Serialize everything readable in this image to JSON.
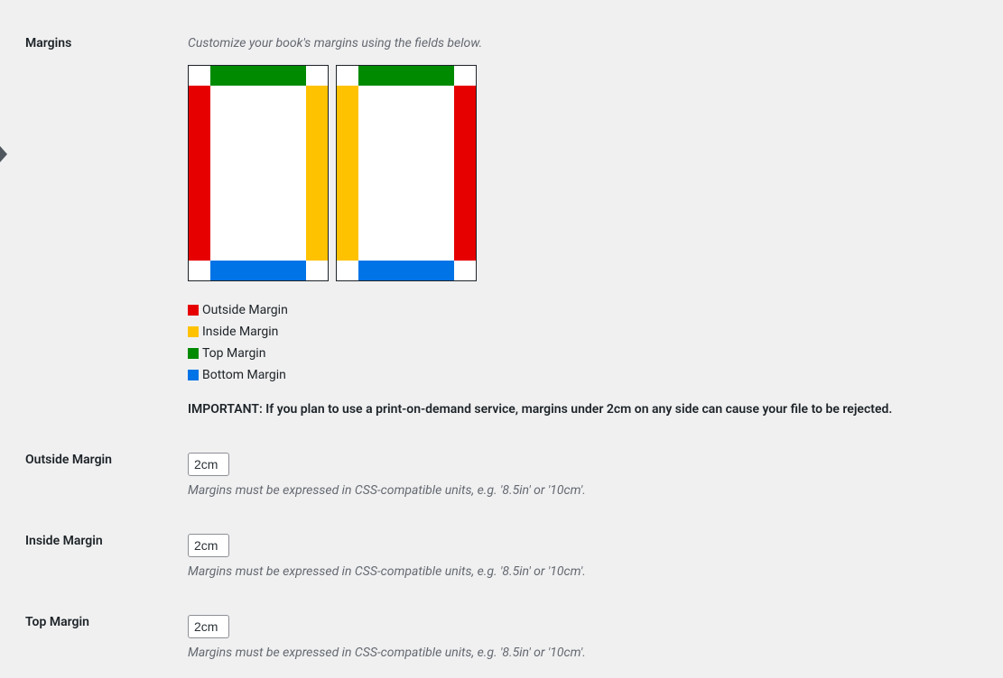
{
  "section": {
    "title": "Margins",
    "description": "Customize your book's margins using the fields below.",
    "important": "IMPORTANT: If you plan to use a print-on-demand service, margins under 2cm on any side can cause your file to be rejected."
  },
  "legend": {
    "outside": "Outside Margin",
    "inside": "Inside Margin",
    "top": "Top Margin",
    "bottom": "Bottom Margin"
  },
  "fields": {
    "outside": {
      "label": "Outside Margin",
      "value": "2cm",
      "help": "Margins must be expressed in CSS-compatible units, e.g. '8.5in' or '10cm'."
    },
    "inside": {
      "label": "Inside Margin",
      "value": "2cm",
      "help": "Margins must be expressed in CSS-compatible units, e.g. '8.5in' or '10cm'."
    },
    "top": {
      "label": "Top Margin",
      "value": "2cm",
      "help": "Margins must be expressed in CSS-compatible units, e.g. '8.5in' or '10cm'."
    }
  }
}
